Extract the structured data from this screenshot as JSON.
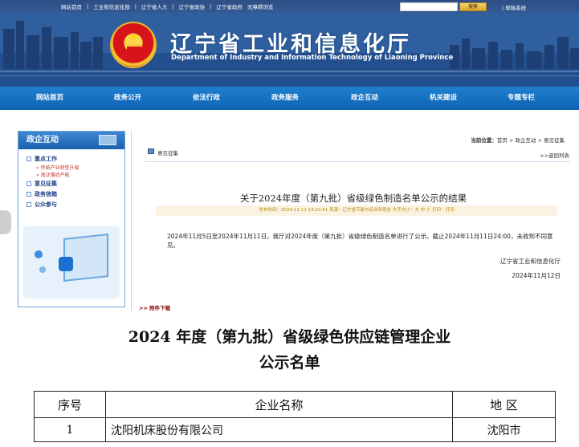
{
  "topbar": {
    "links": [
      "网站首页",
      "工业和信息化部",
      "辽宁省人大",
      "辽宁省政协",
      "辽宁省政府",
      "无障碍浏览"
    ],
    "search_button": "搜索",
    "mail": "邮箱系统"
  },
  "header": {
    "title": "辽宁省工业和信息化厅",
    "subtitle": "Department of Industry and Information Technology of Liaoning Province"
  },
  "nav": {
    "items": [
      "网站首页",
      "政务公开",
      "依法行政",
      "政务服务",
      "政企互动",
      "机关建设",
      "专题专栏"
    ]
  },
  "sidebar": {
    "heading": "政企互动",
    "items": [
      {
        "label": "重点工作",
        "subs": [
          "传统产业转型升级",
          "淘汰落后产能"
        ]
      },
      {
        "label": "意见征集",
        "subs": []
      },
      {
        "label": "政务信箱",
        "subs": []
      },
      {
        "label": "公众参与",
        "subs": []
      }
    ]
  },
  "breadcrumb": {
    "prefix": "当前位置：",
    "path": "首页 > 政企互动 > 意见征集"
  },
  "main": {
    "tab_label": "意见征集",
    "back_link": ">>返回列表",
    "article_title": "关于2024年度（第九批）省级绿色制造名单公示的结果",
    "meta": "发布时间：2024-11-12 14:22:41  来源：辽宁省节能与综合利用处  文字大小：大 中 小  打印：打印",
    "body": "2024年11月5日至2024年11月11日，我厅对2024年度（第九批）省级绿色制造名单进行了公示。截止2024年11月11日24:00，未收到不同意见。",
    "signature_org": "辽宁省工业和信息化厅",
    "signature_date": "2024年11月12日",
    "attachment": ">> 附件下载"
  },
  "document": {
    "title_line1": "2024 年度（第九批）省级绿色供应链管理企业",
    "title_line2": "公示名单",
    "headers": [
      "序号",
      "企业名称",
      "地  区"
    ],
    "rows": [
      [
        "1",
        "沈阳机床股份有限公司",
        "沈阳市"
      ]
    ]
  },
  "colors": {
    "nav_blue": "#1470c2",
    "header_blue": "#2f5f9e",
    "sidebar_blue": "#1a60ae",
    "meta_bg": "#fbf3e2"
  }
}
